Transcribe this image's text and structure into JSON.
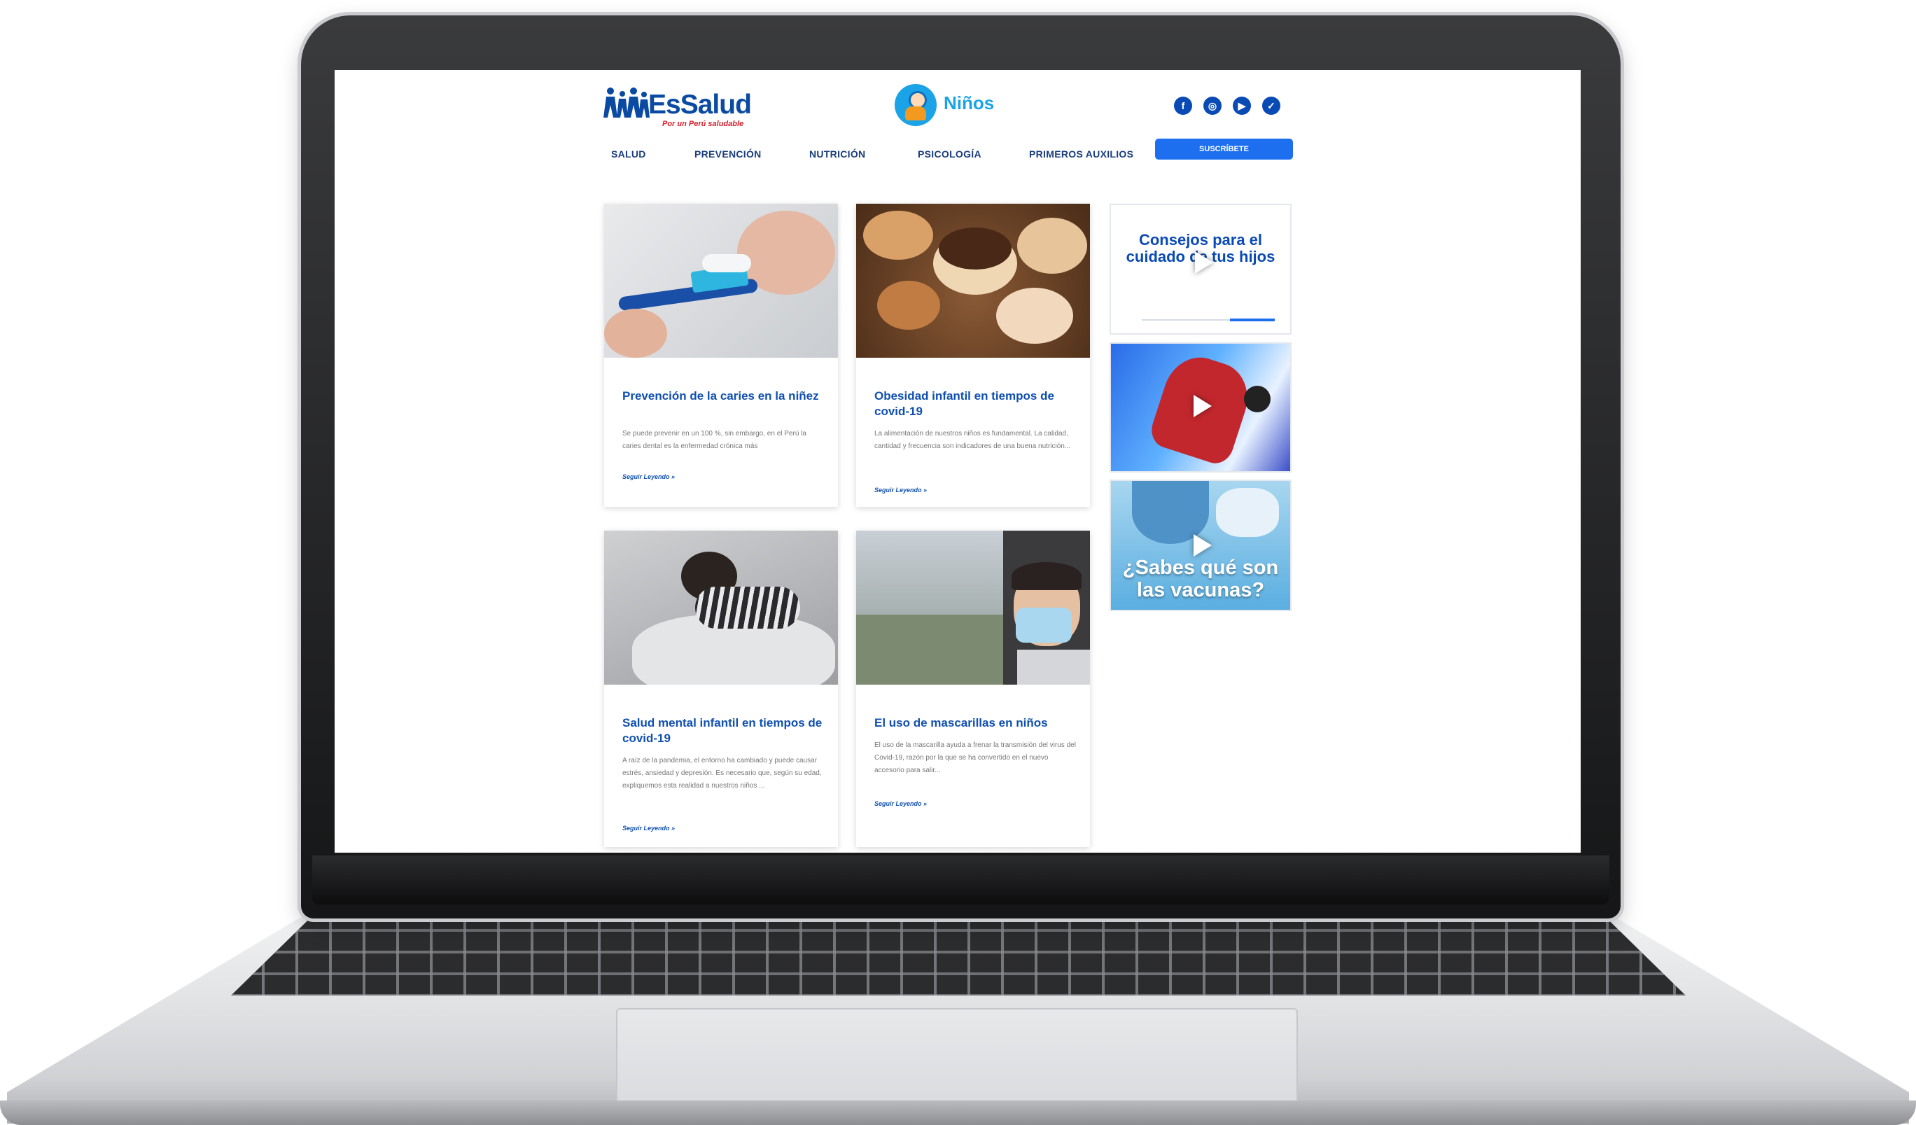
{
  "brand": {
    "name": "EsSalud",
    "tagline": "Por un Perú saludable"
  },
  "section": {
    "name": "Niños"
  },
  "social": [
    {
      "icon": "facebook-icon",
      "glyph": "f"
    },
    {
      "icon": "instagram-icon",
      "glyph": "◎"
    },
    {
      "icon": "youtube-icon",
      "glyph": "▶"
    },
    {
      "icon": "twitter-icon",
      "glyph": "✓"
    }
  ],
  "nav": {
    "items": [
      "SALUD",
      "PREVENCIÓN",
      "NUTRICIÓN",
      "PSICOLOGÍA",
      "PRIMEROS AUXILIOS"
    ],
    "subscribe": "SUSCRÍBETE"
  },
  "cards": [
    {
      "title": "Prevención de la caries en la niñez",
      "excerpt": "Se puede prevenir en un 100 %, sin embargo, en el Perú la caries dental es la enfermedad crónica más",
      "link": "Seguir Leyendo »"
    },
    {
      "title": "Obesidad infantil en tiempos de covid-19",
      "excerpt": "La alimentación de nuestros niños es fundamental. La calidad, cantidad y frecuencia son indicadores de una buena nutrición...",
      "link": "Seguir Leyendo »"
    },
    {
      "title": "Salud mental infantil en tiempos de covid-19",
      "excerpt": "A raíz de la pandemia, el entorno ha cambiado y puede causar estrés, ansiedad y depresión. Es necesario que, según su edad, expliquemos esta realidad a nuestros niños ...",
      "link": "Seguir Leyendo »"
    },
    {
      "title": "El uso de mascarillas en niños",
      "excerpt": "El uso de la mascarilla ayuda a frenar la transmisión del virus del Covid-19, razón por la que se ha convertido en el nuevo accesorio para salir...",
      "link": "Seguir Leyendo »"
    }
  ],
  "videos": [
    {
      "text": "Consejos para el cuidado de tus hijos"
    },
    {
      "text": ""
    },
    {
      "text": "¿Sabes qué son las vacunas?"
    }
  ],
  "colors": {
    "primary": "#0a4ab5",
    "accent": "#1e7bf2",
    "tagline": "#d6202c"
  }
}
